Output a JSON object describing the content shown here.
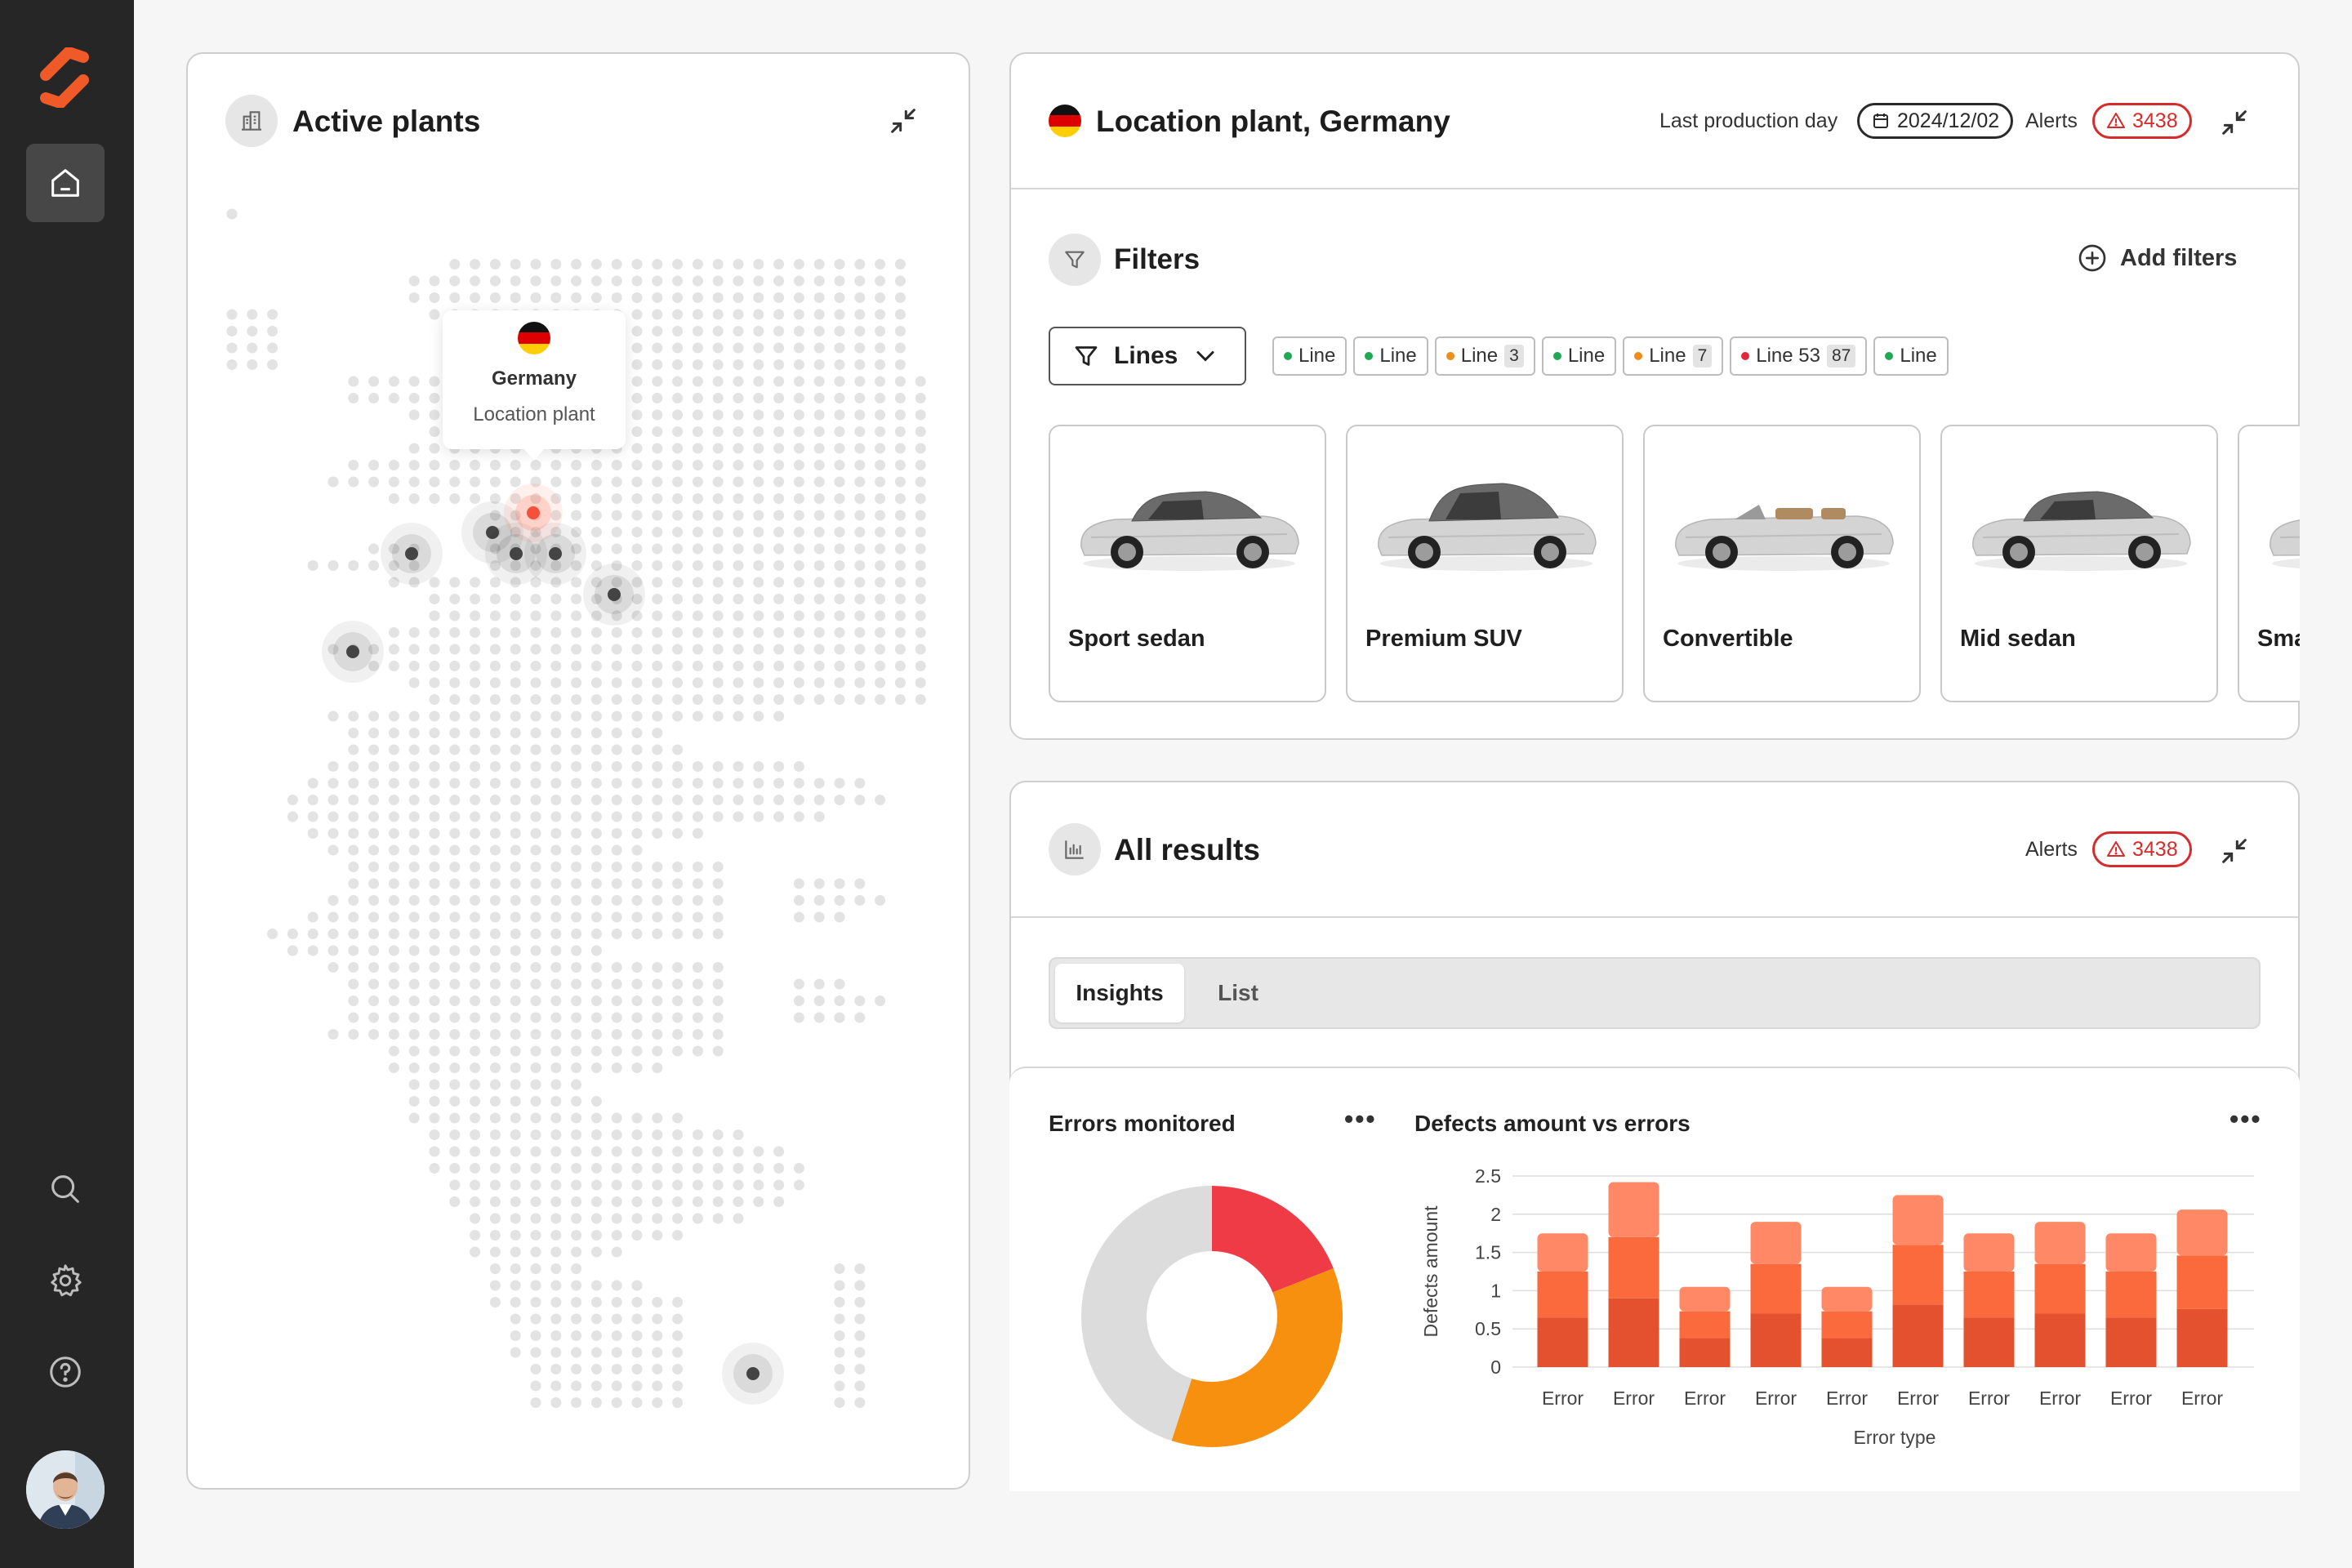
{
  "active_plants": {
    "title": "Active plants",
    "tooltip": {
      "country": "Germany",
      "subtitle": "Location plant"
    }
  },
  "location": {
    "title": "Location plant, Germany",
    "last_production_label": "Last production day",
    "date": "2024/12/02",
    "alerts_label": "Alerts",
    "alerts_count": "3438"
  },
  "filters": {
    "title": "Filters",
    "add_label": "Add filters",
    "dropdown_label": "Lines",
    "chips": [
      {
        "label": "Line",
        "color": "#1fa855",
        "count": ""
      },
      {
        "label": "Line",
        "color": "#1fa855",
        "count": ""
      },
      {
        "label": "Line",
        "color": "#f08c1a",
        "count": "3"
      },
      {
        "label": "Line",
        "color": "#1fa855",
        "count": ""
      },
      {
        "label": "Line",
        "color": "#f08c1a",
        "count": "7"
      },
      {
        "label": "Line 53",
        "color": "#e0283a",
        "count": "87"
      },
      {
        "label": "Line",
        "color": "#1fa855",
        "count": ""
      }
    ]
  },
  "cars": [
    {
      "label": "Sport sedan"
    },
    {
      "label": "Premium SUV"
    },
    {
      "label": "Convertible"
    },
    {
      "label": "Mid sedan"
    },
    {
      "label": "Sma"
    }
  ],
  "results": {
    "title": "All results",
    "alerts_label": "Alerts",
    "alerts_count": "3438",
    "tabs": [
      "Insights",
      "List"
    ]
  },
  "charts": {
    "donut_title": "Errors monitored",
    "bar_title": "Defects amount vs errors",
    "more": "•••"
  },
  "chart_data": [
    {
      "type": "pie",
      "variant": "donut",
      "title": "Errors monitored",
      "slices": [
        {
          "value": 0.19,
          "color": "#ef3b45"
        },
        {
          "value": 0.36,
          "color": "#f7900f"
        },
        {
          "value": 0.45,
          "color": "#dcdcdc"
        }
      ]
    },
    {
      "type": "bar",
      "stacked": true,
      "title": "Defects amount vs errors",
      "xlabel": "Error type",
      "ylabel": "Defects amount",
      "ylim": [
        0,
        2.5
      ],
      "yticks": [
        "0",
        "0.5",
        "1",
        "1.5",
        "2",
        "2.5"
      ],
      "categories": [
        "Error",
        "Error",
        "Error",
        "Error",
        "Error",
        "Error",
        "Error",
        "Error",
        "Error",
        "Error"
      ],
      "series": [
        {
          "values": [
            0.65,
            0.9,
            0.38,
            0.7,
            0.38,
            0.82,
            0.65,
            0.7,
            0.65,
            0.76
          ],
          "color": "#e4512e"
        },
        {
          "values": [
            0.6,
            0.8,
            0.35,
            0.65,
            0.35,
            0.78,
            0.6,
            0.65,
            0.6,
            0.7
          ],
          "color": "#fa6a3c"
        },
        {
          "values": [
            0.5,
            0.72,
            0.32,
            0.55,
            0.32,
            0.65,
            0.5,
            0.55,
            0.5,
            0.6
          ],
          "color": "#ff8866"
        }
      ]
    }
  ]
}
